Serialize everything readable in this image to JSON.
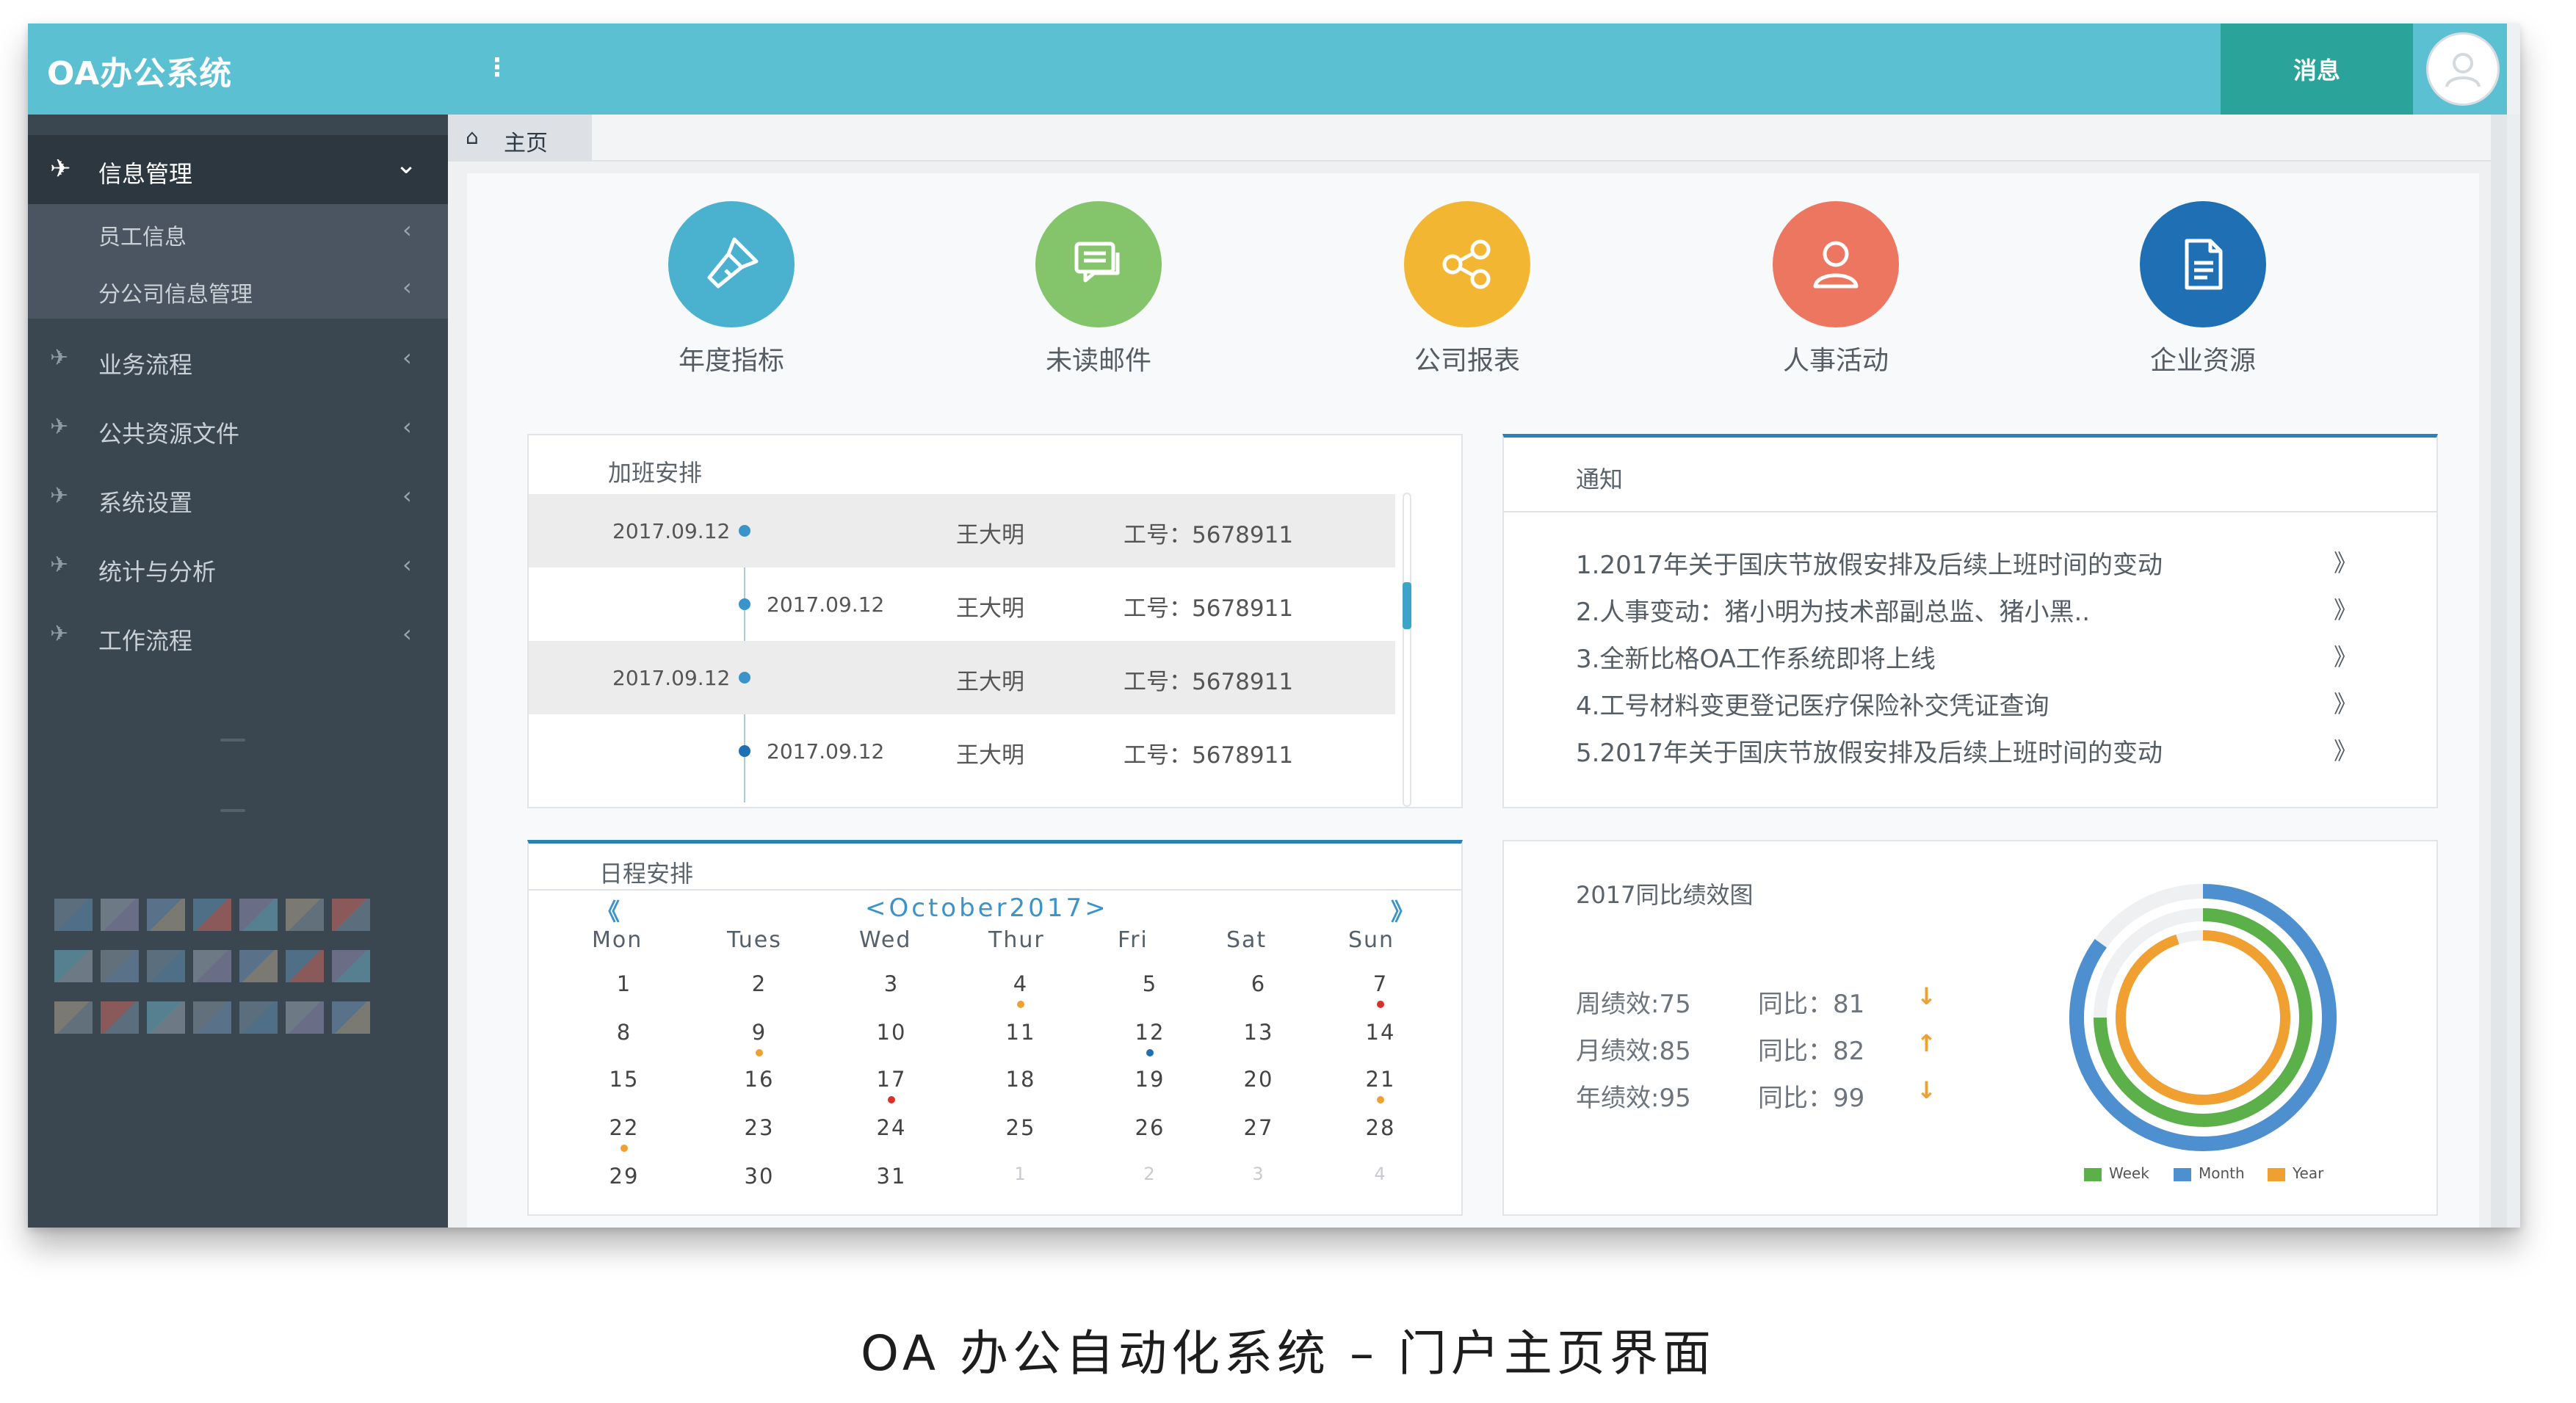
{
  "app": {
    "title": "OA办公系统",
    "menu_icon": "kebab-icon"
  },
  "header": {
    "message_button": "消息",
    "avatar_icon": "user-avatar-icon"
  },
  "sidebar": {
    "expanded": {
      "label": "信息管理",
      "icon": "rocket-icon",
      "chevron": "chevron-down-icon"
    },
    "sub_items": [
      {
        "label": "员工信息"
      },
      {
        "label": "分公司信息管理"
      }
    ],
    "items": [
      {
        "label": "业务流程",
        "icon": "rocket-icon"
      },
      {
        "label": "公共资源文件",
        "icon": "rocket-icon"
      },
      {
        "label": "系统设置",
        "icon": "rocket-icon"
      },
      {
        "label": "统计与分析",
        "icon": "rocket-icon"
      },
      {
        "label": "工作流程",
        "icon": "rocket-icon"
      }
    ],
    "arrow": "‹"
  },
  "tabs": {
    "home_label": "主页",
    "home_icon": "home-icon"
  },
  "quick_links": [
    {
      "label": "年度指标",
      "icon": "flashlight-icon",
      "color": "#4ab1cf"
    },
    {
      "label": "未读邮件",
      "icon": "chat-icon",
      "color": "#84c46a"
    },
    {
      "label": "公司报表",
      "icon": "share-icon",
      "color": "#f2b632"
    },
    {
      "label": "人事活动",
      "icon": "person-icon",
      "color": "#ec7660"
    },
    {
      "label": "企业资源",
      "icon": "document-icon",
      "color": "#1e6fb3"
    }
  ],
  "overtime": {
    "title": "加班安排",
    "rows": [
      {
        "date": "2017.09.12",
        "name": "王大明",
        "id": "工号：5678911"
      },
      {
        "date": "2017.09.12",
        "name": "王大明",
        "id": "工号：5678911"
      },
      {
        "date": "2017.09.12",
        "name": "王大明",
        "id": "工号：5678911"
      },
      {
        "date": "2017.09.12",
        "name": "王大明",
        "id": "工号：5678911"
      }
    ]
  },
  "notices": {
    "title": "通知",
    "arrow": "》",
    "items": [
      "1.2017年关于国庆节放假安排及后续上班时间的变动",
      "2.人事变动：猪小明为技术部副总监、猪小黑..",
      "3.全新比格OA工作系统即将上线",
      "4.工号材料变更登记医疗保险补交凭证查询",
      "5.2017年关于国庆节放假安排及后续上班时间的变动"
    ]
  },
  "schedule": {
    "title": "日程安排",
    "month_label": "<October2017>",
    "prev": "《",
    "next": "》",
    "weekdays": [
      "Mon",
      "Tues",
      "Wed",
      "Thur",
      "Fri",
      "Sat",
      "Sun"
    ],
    "weeks": [
      [
        "1",
        "2",
        "3",
        "4",
        "5",
        "6",
        "7"
      ],
      [
        "8",
        "9",
        "10",
        "11",
        "12",
        "13",
        "14"
      ],
      [
        "15",
        "16",
        "17",
        "18",
        "19",
        "20",
        "21"
      ],
      [
        "22",
        "23",
        "24",
        "25",
        "26",
        "27",
        "28"
      ],
      [
        "29",
        "30",
        "31",
        "1",
        "2",
        "3",
        "4"
      ]
    ],
    "dim_cells": [
      [
        4,
        3
      ],
      [
        4,
        4
      ],
      [
        4,
        5
      ],
      [
        4,
        6
      ]
    ],
    "markers": [
      {
        "week": 0,
        "day": 3,
        "color": "#f0a030"
      },
      {
        "week": 0,
        "day": 6,
        "color": "#d9302a"
      },
      {
        "week": 1,
        "day": 1,
        "color": "#f0a030"
      },
      {
        "week": 1,
        "day": 4,
        "color": "#1e6fb3"
      },
      {
        "week": 2,
        "day": 2,
        "color": "#d9302a"
      },
      {
        "week": 2,
        "day": 6,
        "color": "#f0a030"
      },
      {
        "week": 3,
        "day": 0,
        "color": "#f0a030"
      }
    ]
  },
  "performance": {
    "title": "2017同比绩效图",
    "rows": [
      {
        "label": "周绩效:75",
        "compare": "同比：81",
        "arrow": "↓"
      },
      {
        "label": "月绩效:85",
        "compare": "同比：82",
        "arrow": "↑"
      },
      {
        "label": "年绩效:95",
        "compare": "同比：99",
        "arrow": "↓"
      }
    ],
    "chart_data": {
      "type": "radial-bar",
      "series": [
        {
          "name": "Week",
          "value": 75,
          "color": "#5cb04a"
        },
        {
          "name": "Month",
          "value": 85,
          "color": "#4e8fcf"
        },
        {
          "name": "Year",
          "value": 95,
          "color": "#f0a030"
        }
      ],
      "max": 100,
      "legend": "bottom"
    }
  },
  "caption": "OA 办公自动化系统 – 门户主页界面"
}
